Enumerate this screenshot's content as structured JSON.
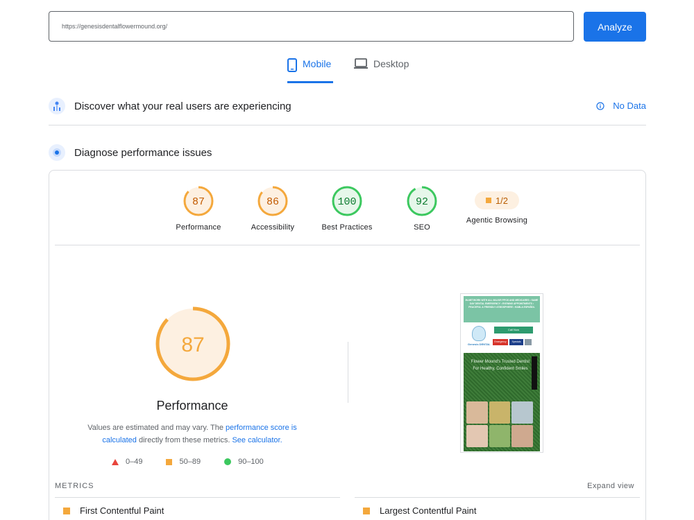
{
  "url_bar": {
    "value": "https://genesisdentalflowermound.org/",
    "analyze_label": "Analyze"
  },
  "tabs": [
    {
      "label": "Mobile",
      "icon": "phone-icon",
      "active": true
    },
    {
      "label": "Desktop",
      "icon": "laptop-icon",
      "active": false
    }
  ],
  "field_data": {
    "title": "Discover what your real users are experiencing",
    "no_data_label": "No Data"
  },
  "diagnose": {
    "title": "Diagnose performance issues"
  },
  "categories": [
    {
      "label": "Performance",
      "score": 87,
      "color": "#f4a83c"
    },
    {
      "label": "Accessibility",
      "score": 86,
      "color": "#f4a83c"
    },
    {
      "label": "Best Practices",
      "score": 100,
      "color": "#3cc85f"
    },
    {
      "label": "SEO",
      "score": 92,
      "color": "#3cc85f"
    },
    {
      "label": "Agentic Browsing",
      "score_text": "1/2",
      "color": "#f4a83c"
    }
  ],
  "performance_detail": {
    "score": 87,
    "title": "Performance",
    "note_prefix": "Values are estimated and may vary. The ",
    "note_link1": "performance score is calculated",
    "note_middle": " directly from these metrics. ",
    "note_link2": "See calculator.",
    "legend": [
      {
        "shape": "triangle",
        "range": "0–49",
        "color": "#e8453c"
      },
      {
        "shape": "square",
        "range": "50–89",
        "color": "#f4a83c"
      },
      {
        "shape": "circle",
        "range": "90–100",
        "color": "#3cc85f"
      }
    ]
  },
  "screenshot": {
    "banner_text": "IN-NETWORK WITH ALL MAJOR PPOS AND MEDICARES • SAME DAY DENTAL EMERGENCY • EVENING APPOINTMENTS • PEACEFUL & FRIENDLY ATMOSPHERE • HABLA ESPAÑOL",
    "brand_text": "Genesis DENTAL",
    "call_now": "Call Now",
    "pill_red": "Emergency",
    "pill_navy": "Specials",
    "grass_text": "Flower Mound's Trusted Dentist For Healthy, Confident Smiles"
  },
  "metrics": {
    "header": "METRICS",
    "expand_label": "Expand view",
    "items": [
      {
        "label": "First Contentful Paint",
        "status_color": "#f4a83c"
      },
      {
        "label": "Largest Contentful Paint",
        "status_color": "#f4a83c"
      }
    ]
  }
}
